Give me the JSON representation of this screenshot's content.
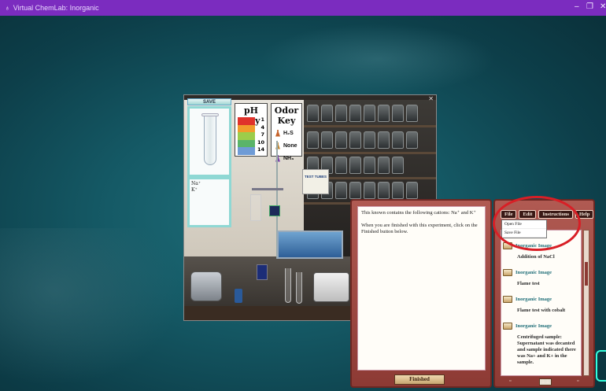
{
  "window": {
    "title": "Virtual ChemLab: Inorganic",
    "minimize": "–",
    "maximize": "❐",
    "close": "✕"
  },
  "lab": {
    "close": "✕",
    "save_label": "SAVE",
    "tube_ions": [
      "Na⁺",
      "K⁺"
    ],
    "ph_key": {
      "title": "pH Key",
      "values": [
        "1",
        "4",
        "7",
        "10",
        "14"
      ],
      "colors": [
        "#e0322b",
        "#f19c2c",
        "#9ccd4a",
        "#5ab46a",
        "#6e9bd6"
      ]
    },
    "odor_key": {
      "title": "Odor Key",
      "items": [
        {
          "label": "H₂S",
          "color": "#c7642c"
        },
        {
          "label": "None",
          "color": "#c08a3a"
        },
        {
          "label": "NH₃",
          "color": "#7a44a8"
        }
      ]
    },
    "test_tubes_box": "TEST TUBES"
  },
  "instructions": {
    "line1": "This known contains the following cations: Na⁺ and K⁺",
    "line2": "When you are finished with this experiment, click on the Finished button below.",
    "finished_button": "Finished"
  },
  "notebook": {
    "menu": [
      "File",
      "Edit",
      "Instructions",
      "Help"
    ],
    "dropdown": [
      "Open File",
      "Save File"
    ],
    "entries": [
      {
        "link": "Inorganic Image",
        "text": "Addition of NaCl"
      },
      {
        "link": "Inorganic Image",
        "text": "Flame test"
      },
      {
        "link": "Inorganic Image",
        "text": "Flame test with cobalt"
      },
      {
        "link": "Inorganic Image",
        "text": "Centrifuged sample: Supernatant was decanted and sample indicated there was Na+ and K+ in the sample."
      }
    ],
    "page": "1 1"
  }
}
